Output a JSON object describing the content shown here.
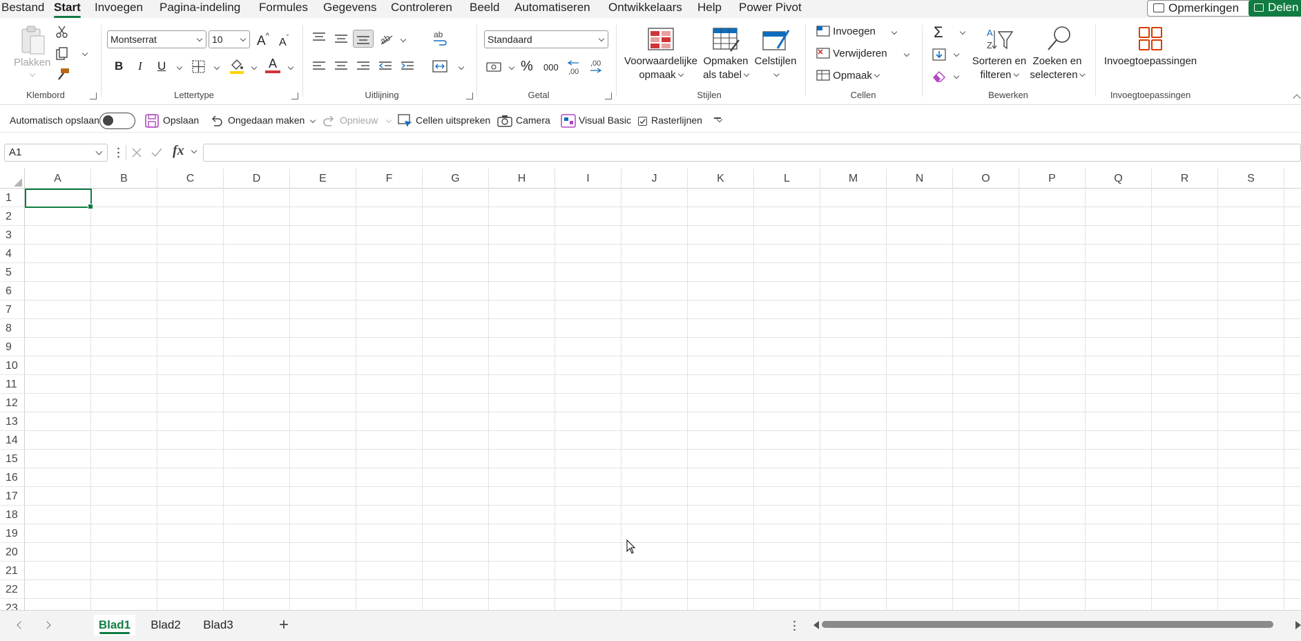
{
  "menu": {
    "tabs": [
      "Bestand",
      "Start",
      "Invoegen",
      "Pagina-indeling",
      "Formules",
      "Gegevens",
      "Controleren",
      "Beeld",
      "Automatiseren",
      "Ontwikkelaars",
      "Help",
      "Power Pivot"
    ],
    "active": "Start",
    "comments_label": "Opmerkingen",
    "share_label": "Delen"
  },
  "ribbon": {
    "klembord": {
      "label": "Klembord",
      "paste": "Plakken"
    },
    "lettertype": {
      "label": "Lettertype",
      "font": "Montserrat",
      "size": "10"
    },
    "uitlijning": {
      "label": "Uitlijning"
    },
    "getal": {
      "label": "Getal",
      "format": "Standaard"
    },
    "stijlen": {
      "label": "Stijlen",
      "conditional_1": "Voorwaardelijke",
      "conditional_2": "opmaak",
      "table_1": "Opmaken",
      "table_2": "als tabel",
      "cellstyles": "Celstijlen"
    },
    "cellen": {
      "label": "Cellen",
      "insert": "Invoegen",
      "delete": "Verwijderen",
      "format": "Opmaak"
    },
    "bewerken": {
      "label": "Bewerken",
      "sort_1": "Sorteren en",
      "sort_2": "filteren",
      "find_1": "Zoeken en",
      "find_2": "selecteren"
    },
    "addins": {
      "label": "Invoegtoepassingen",
      "button": "Invoegtoepassingen"
    }
  },
  "qat": {
    "autosave": "Automatisch opslaan",
    "save": "Opslaan",
    "undo": "Ongedaan maken",
    "redo": "Opnieuw",
    "speak": "Cellen uitspreken",
    "camera": "Camera",
    "vb": "Visual Basic",
    "gridlines": "Rasterlijnen"
  },
  "formula_bar": {
    "name_box": "A1",
    "formula": ""
  },
  "grid": {
    "columns": [
      "A",
      "B",
      "C",
      "D",
      "E",
      "F",
      "G",
      "H",
      "I",
      "J",
      "K",
      "L",
      "M",
      "N",
      "O",
      "P",
      "Q",
      "R",
      "S"
    ],
    "rows": [
      "1",
      "2",
      "3",
      "4",
      "5",
      "6",
      "7",
      "8",
      "9",
      "10",
      "11",
      "12",
      "13",
      "14",
      "15",
      "16",
      "17",
      "18",
      "19",
      "20",
      "21",
      "22",
      "23"
    ]
  },
  "sheets": {
    "tabs": [
      "Blad1",
      "Blad2",
      "Blad3"
    ],
    "active": "Blad1"
  },
  "colors": {
    "accent": "#107c41",
    "font_red": "#d13438",
    "highlight_yellow": "#ffd500"
  }
}
